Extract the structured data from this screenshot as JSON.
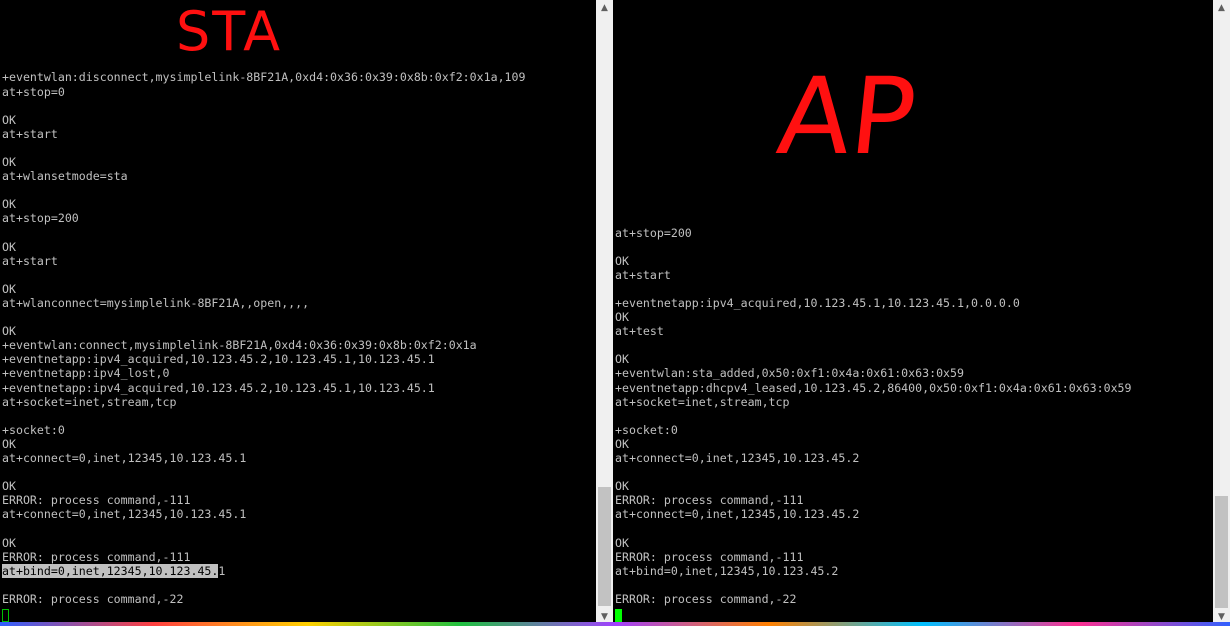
{
  "colors": {
    "terminal_bg": "#000000",
    "terminal_text": "#c0c0c0",
    "annotation": "#ff1010",
    "cursor": "#00ff00",
    "selection": "#c0c0c0"
  },
  "left_terminal": {
    "annotation": "STA",
    "lines": [
      "",
      "",
      "",
      "",
      "",
      "+eventwlan:disconnect,mysimplelink-8BF21A,0xd4:0x36:0x39:0x8b:0xf2:0x1a,109",
      "at+stop=0",
      "",
      "OK",
      "at+start",
      "",
      "OK",
      "at+wlansetmode=sta",
      "",
      "OK",
      "at+stop=200",
      "",
      "OK",
      "at+start",
      "",
      "OK",
      "at+wlanconnect=mysimplelink-8BF21A,,open,,,,",
      "",
      "OK",
      "+eventwlan:connect,mysimplelink-8BF21A,0xd4:0x36:0x39:0x8b:0xf2:0x1a",
      "+eventnetapp:ipv4_acquired,10.123.45.2,10.123.45.1,10.123.45.1",
      "+eventnetapp:ipv4_lost,0",
      "+eventnetapp:ipv4_acquired,10.123.45.2,10.123.45.1,10.123.45.1",
      "at+socket=inet,stream,tcp",
      "",
      "+socket:0",
      "OK",
      "at+connect=0,inet,12345,10.123.45.1",
      "",
      "OK",
      "ERROR: process command,-111",
      "at+connect=0,inet,12345,10.123.45.1",
      "",
      "OK",
      "ERROR: process command,-111"
    ],
    "selected_line_a": "at+bind=0,inet,12345,10.123.45.",
    "selected_line_b": "1",
    "after_lines": [
      "",
      "ERROR: process command,-22"
    ]
  },
  "right_terminal": {
    "annotation": "AP",
    "lines": [
      "",
      "",
      "",
      "",
      "",
      "",
      "",
      "",
      "",
      "",
      "",
      "",
      "",
      "",
      "",
      "",
      "at+stop=200",
      "",
      "OK",
      "at+start",
      "",
      "+eventnetapp:ipv4_acquired,10.123.45.1,10.123.45.1,0.0.0.0",
      "OK",
      "at+test",
      "",
      "OK",
      "+eventwlan:sta_added,0x50:0xf1:0x4a:0x61:0x63:0x59",
      "+eventnetapp:dhcpv4_leased,10.123.45.2,86400,0x50:0xf1:0x4a:0x61:0x63:0x59",
      "at+socket=inet,stream,tcp",
      "",
      "+socket:0",
      "OK",
      "at+connect=0,inet,12345,10.123.45.2",
      "",
      "OK",
      "ERROR: process command,-111",
      "at+connect=0,inet,12345,10.123.45.2",
      "",
      "OK",
      "ERROR: process command,-111",
      "at+bind=0,inet,12345,10.123.45.2",
      "",
      "ERROR: process command,-22"
    ]
  },
  "scrollbar": {
    "up_arrow": "▲",
    "down_arrow": "▼"
  }
}
